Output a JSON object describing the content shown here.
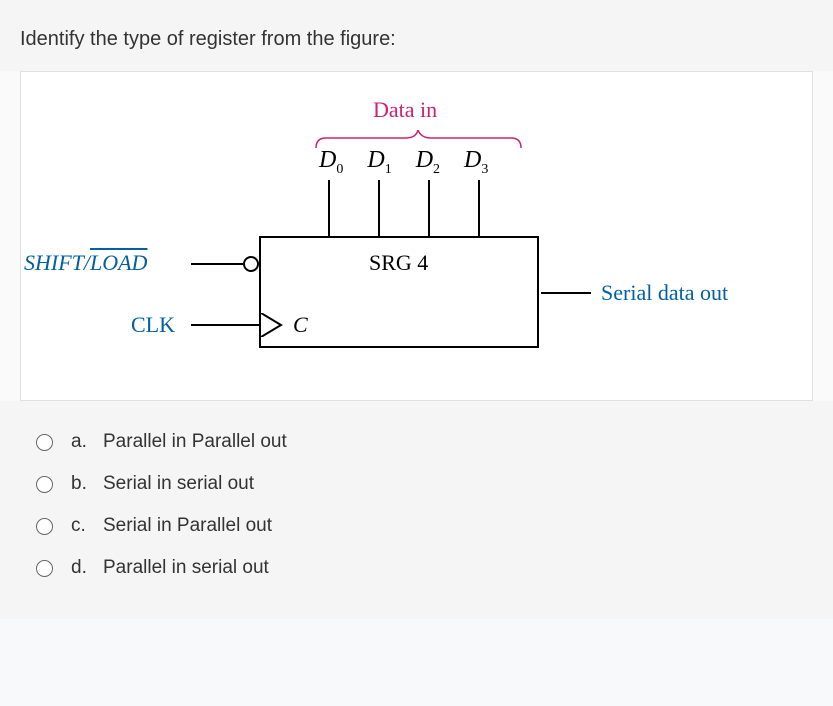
{
  "question": "Identify the type of register from the figure:",
  "figure": {
    "data_in_label": "Data in",
    "d_labels": [
      "D",
      "D",
      "D",
      "D"
    ],
    "d_subs": [
      "0",
      "1",
      "2",
      "3"
    ],
    "srg_label": "SRG 4",
    "shift_load": "SHIFT/",
    "shift_load_overline": "LOAD",
    "clk_label": "CLK",
    "c_label": "C",
    "serial_out": "Serial data out"
  },
  "options": [
    {
      "letter": "a.",
      "text": "Parallel in Parallel out"
    },
    {
      "letter": "b.",
      "text": "Serial in serial out"
    },
    {
      "letter": "c.",
      "text": "Serial in Parallel out"
    },
    {
      "letter": "d.",
      "text": "Parallel in serial out"
    }
  ]
}
